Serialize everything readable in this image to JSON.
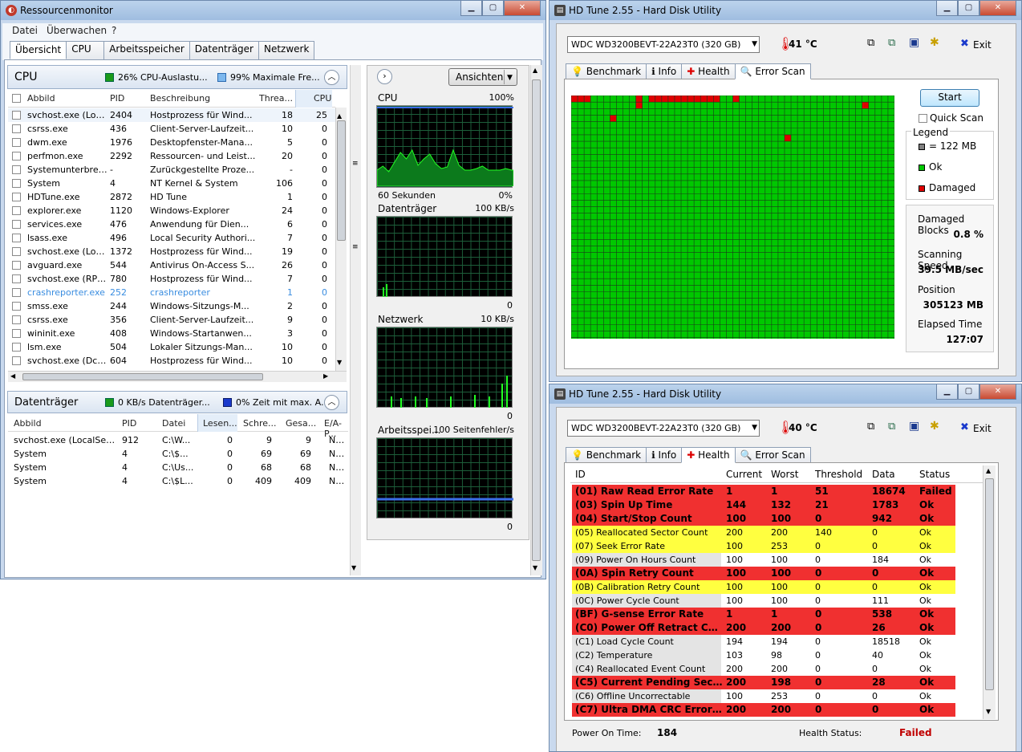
{
  "rm": {
    "title": "Ressourcenmonitor",
    "menu": [
      "Datei",
      "Überwachen",
      "?"
    ],
    "tabs": [
      "Übersicht",
      "CPU",
      "Arbeitsspeicher",
      "Datenträger",
      "Netzwerk"
    ],
    "cpu": {
      "title": "CPU",
      "stat1": "26% CPU-Auslastu...",
      "stat2": "99% Maximale Fre...",
      "columns": [
        "Abbild",
        "PID",
        "Beschreibung",
        "Threa...",
        "CPU"
      ],
      "rows": [
        [
          "svchost.exe (Loc...",
          "2404",
          "Hostprozess für Wind...",
          "18",
          "25"
        ],
        [
          "csrss.exe",
          "436",
          "Client-Server-Laufzeit...",
          "10",
          "0"
        ],
        [
          "dwm.exe",
          "1976",
          "Desktopfenster-Mana...",
          "5",
          "0"
        ],
        [
          "perfmon.exe",
          "2292",
          "Ressourcen- und Leist...",
          "20",
          "0"
        ],
        [
          "Systemunterbrec...",
          "-",
          "Zurückgestellte Proze...",
          "-",
          "0"
        ],
        [
          "System",
          "4",
          "NT Kernel & System",
          "106",
          "0"
        ],
        [
          "HDTune.exe",
          "2872",
          "HD Tune",
          "1",
          "0"
        ],
        [
          "explorer.exe",
          "1120",
          "Windows-Explorer",
          "24",
          "0"
        ],
        [
          "services.exe",
          "476",
          "Anwendung für Dien...",
          "6",
          "0"
        ],
        [
          "lsass.exe",
          "496",
          "Local Security Authori...",
          "7",
          "0"
        ],
        [
          "svchost.exe (Loc...",
          "1372",
          "Hostprozess für Wind...",
          "19",
          "0"
        ],
        [
          "avguard.exe",
          "544",
          "Antivirus On-Access S...",
          "26",
          "0"
        ],
        [
          "svchost.exe (RPC...",
          "780",
          "Hostprozess für Wind...",
          "7",
          "0"
        ],
        [
          "crashreporter.exe",
          "252",
          "crashreporter",
          "1",
          "0"
        ],
        [
          "smss.exe",
          "244",
          "Windows-Sitzungs-M...",
          "2",
          "0"
        ],
        [
          "csrss.exe",
          "356",
          "Client-Server-Laufzeit...",
          "9",
          "0"
        ],
        [
          "wininit.exe",
          "408",
          "Windows-Startanwen...",
          "3",
          "0"
        ],
        [
          "lsm.exe",
          "504",
          "Lokaler Sitzungs-Man...",
          "10",
          "0"
        ],
        [
          "svchost.exe (Dco...",
          "604",
          "Hostprozess für Wind...",
          "10",
          "0"
        ]
      ],
      "highlight_color": "#3a8de0"
    },
    "disk": {
      "title": "Datenträger",
      "stat1": "0 KB/s Datenträger...",
      "stat2": "0% Zeit mit max. A...",
      "columns": [
        "Abbild",
        "PID",
        "Datei",
        "Lesen...",
        "Schre...",
        "Gesa...",
        "E/A-P..."
      ],
      "rows": [
        [
          "svchost.exe (LocalServi...",
          "912",
          "C:\\W...",
          "0",
          "9",
          "9",
          "Nor..."
        ],
        [
          "System",
          "4",
          "C:\\$...",
          "0",
          "69",
          "69",
          "Nor..."
        ],
        [
          "System",
          "4",
          "C:\\Us...",
          "0",
          "68",
          "68",
          "Nor..."
        ],
        [
          "System",
          "4",
          "C:\\$L...",
          "0",
          "409",
          "409",
          "Nor..."
        ]
      ]
    },
    "views_button": "Ansichten",
    "graphs": [
      {
        "name": "CPU",
        "max": "100%",
        "footer_left": "60 Sekunden",
        "footer_right": "0%"
      },
      {
        "name": "Datenträger",
        "max": "100 KB/s",
        "footer_left": "",
        "footer_right": "0"
      },
      {
        "name": "Netzwerk",
        "max": "10 KB/s",
        "footer_left": "",
        "footer_right": "0"
      },
      {
        "name": "Arbeitsspei...",
        "max": "100 Seitenfehler/s",
        "footer_left": "",
        "footer_right": "0"
      }
    ]
  },
  "hdt1": {
    "title": "HD Tune 2.55 - Hard Disk Utility",
    "drive": "WDC WD3200BEVT-22A23T0 (320 GB)",
    "temp": "41 °C",
    "exit": "Exit",
    "tabs": [
      "Benchmark",
      "Info",
      "Health",
      "Error Scan"
    ],
    "start": "Start",
    "quick_scan": "Quick Scan",
    "legend_title": "Legend",
    "legend": [
      "= 122 MB",
      "Ok",
      "Damaged"
    ],
    "stats": [
      {
        "label": "Damaged Blocks",
        "value": "0.8 %"
      },
      {
        "label": "Scanning Speed",
        "value": "39.5 MB/sec"
      },
      {
        "label": "Position",
        "value": "305123 MB"
      },
      {
        "label": "Elapsed Time",
        "value": "127:07"
      }
    ],
    "colors": {
      "ok": "#00c800",
      "damaged": "#e00000"
    }
  },
  "hdt2": {
    "title": "HD Tune 2.55 - Hard Disk Utility",
    "drive": "WDC WD3200BEVT-22A23T0 (320 GB)",
    "temp": "40 °C",
    "exit": "Exit",
    "tabs": [
      "Benchmark",
      "Info",
      "Health",
      "Error Scan"
    ],
    "columns": [
      "ID",
      "Current",
      "Worst",
      "Threshold",
      "Data",
      "Status"
    ],
    "rows": [
      {
        "id": "(01) Raw Read Error Rate",
        "cur": "1",
        "worst": "1",
        "thr": "51",
        "data": "18674",
        "status": "Failed",
        "c": "red"
      },
      {
        "id": "(03) Spin Up Time",
        "cur": "144",
        "worst": "132",
        "thr": "21",
        "data": "1783",
        "status": "Ok",
        "c": "red"
      },
      {
        "id": "(04) Start/Stop Count",
        "cur": "100",
        "worst": "100",
        "thr": "0",
        "data": "942",
        "status": "Ok",
        "c": "red"
      },
      {
        "id": "(05) Reallocated Sector Count",
        "cur": "200",
        "worst": "200",
        "thr": "140",
        "data": "0",
        "status": "Ok",
        "c": "yellow"
      },
      {
        "id": "(07) Seek Error Rate",
        "cur": "100",
        "worst": "253",
        "thr": "0",
        "data": "0",
        "status": "Ok",
        "c": "yellow"
      },
      {
        "id": "(09) Power On Hours Count",
        "cur": "100",
        "worst": "100",
        "thr": "0",
        "data": "184",
        "status": "Ok",
        "c": "gray"
      },
      {
        "id": "(0A) Spin Retry Count",
        "cur": "100",
        "worst": "100",
        "thr": "0",
        "data": "0",
        "status": "Ok",
        "c": "red"
      },
      {
        "id": "(0B) Calibration Retry Count",
        "cur": "100",
        "worst": "100",
        "thr": "0",
        "data": "0",
        "status": "Ok",
        "c": "yellow"
      },
      {
        "id": "(0C) Power Cycle Count",
        "cur": "100",
        "worst": "100",
        "thr": "0",
        "data": "111",
        "status": "Ok",
        "c": "gray"
      },
      {
        "id": "(BF) G-sense Error Rate",
        "cur": "1",
        "worst": "1",
        "thr": "0",
        "data": "538",
        "status": "Ok",
        "c": "red"
      },
      {
        "id": "(C0) Power Off Retract Count",
        "cur": "200",
        "worst": "200",
        "thr": "0",
        "data": "26",
        "status": "Ok",
        "c": "red"
      },
      {
        "id": "(C1) Load Cycle Count",
        "cur": "194",
        "worst": "194",
        "thr": "0",
        "data": "18518",
        "status": "Ok",
        "c": "gray"
      },
      {
        "id": "(C2) Temperature",
        "cur": "103",
        "worst": "98",
        "thr": "0",
        "data": "40",
        "status": "Ok",
        "c": "gray"
      },
      {
        "id": "(C4) Reallocated Event Count",
        "cur": "200",
        "worst": "200",
        "thr": "0",
        "data": "0",
        "status": "Ok",
        "c": "gray"
      },
      {
        "id": "(C5) Current Pending Sector",
        "cur": "200",
        "worst": "198",
        "thr": "0",
        "data": "28",
        "status": "Ok",
        "c": "red"
      },
      {
        "id": "(C6) Offline Uncorrectable",
        "cur": "100",
        "worst": "253",
        "thr": "0",
        "data": "0",
        "status": "Ok",
        "c": "gray"
      },
      {
        "id": "(C7) Ultra DMA CRC Error Co...",
        "cur": "200",
        "worst": "200",
        "thr": "0",
        "data": "0",
        "status": "Ok",
        "c": "red"
      }
    ],
    "power_on_label": "Power On Time:",
    "power_on_value": "184",
    "health_label": "Health Status:",
    "health_value": "Failed",
    "colors": {
      "red": "#f03030",
      "yellow": "#ffff40",
      "gray": "#e4e4e4",
      "failed_text": "#c00000"
    }
  }
}
